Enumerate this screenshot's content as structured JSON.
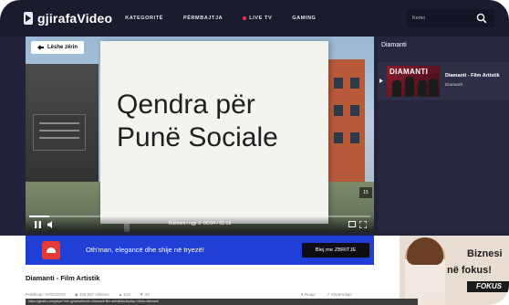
{
  "header": {
    "logo_text": "gjirafaVideo",
    "nav": [
      {
        "label": "KATEGORITË"
      },
      {
        "label": "PËRMBAJTJA"
      },
      {
        "label": "LIVE TV"
      },
      {
        "label": "GAMING"
      }
    ],
    "search_placeholder": "Kerko"
  },
  "player": {
    "back_label": "Lëshe zërin",
    "sign_line1": "Qendra për",
    "sign_line2": "Punë Sociale",
    "skip_label": "15",
    "time_text": "Rikthimi i ngjr 2: 00:04 / 01:19",
    "progress": 0.06
  },
  "playlist": {
    "title": "Diamanti",
    "items": [
      {
        "thumb_text": "DIAMANTI",
        "name": "Diamanti - Film Artistik",
        "category": "Diamanti"
      }
    ]
  },
  "ad_banner": {
    "text": "Oth'man, elegancë dhe shije në tryezë!",
    "cta": "Blej me ZBRITJE"
  },
  "side_ad": {
    "line1": "Biznesi",
    "line2": "në fokus!",
    "badge": "FOKUS"
  },
  "video": {
    "title": "Diamanti - Film Artistik",
    "published": "Publikuar: 07/01/2019",
    "views": "428,987 shikime",
    "likes": "615",
    "dislikes": "33",
    "save": "Ruaje",
    "share": "Shpërndaje"
  },
  "status_url": "https://gjirafa.com/player?ref=gjirafavideo&v=diamanti-film-artistik&autoplay=1&list=diamanti"
}
